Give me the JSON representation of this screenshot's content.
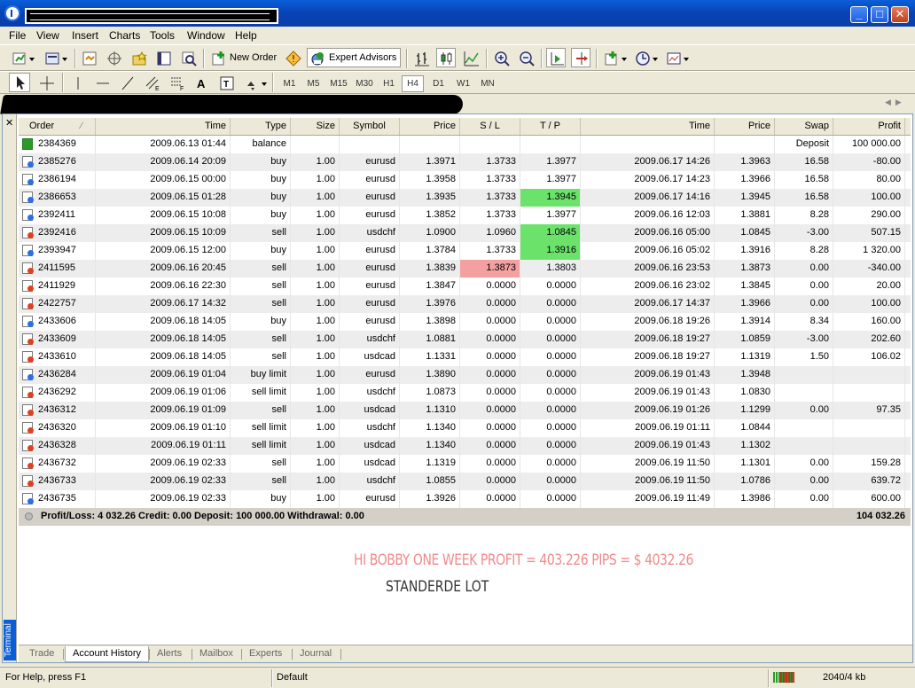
{
  "window": {
    "title": ""
  },
  "menu": [
    "File",
    "View",
    "Insert",
    "Charts",
    "Tools",
    "Window",
    "Help"
  ],
  "toolbar1": {
    "new_order": "New Order",
    "expert_advisors": "Expert Advisors"
  },
  "timeframes": [
    "M1",
    "M5",
    "M15",
    "M30",
    "H1",
    "H4",
    "D1",
    "W1",
    "MN"
  ],
  "timeframe_selected": "H4",
  "table": {
    "columns": [
      "Order",
      "Time",
      "Type",
      "Size",
      "Symbol",
      "Price",
      "S / L",
      "T / P",
      "Time",
      "Price",
      "Swap",
      "Profit"
    ],
    "rows": [
      [
        "2384369",
        "2009.06.13 01:44",
        "balance",
        "",
        "",
        "",
        "",
        "",
        "",
        "",
        "Deposit",
        "100 000.00"
      ],
      [
        "2385276",
        "2009.06.14 20:09",
        "buy",
        "1.00",
        "eurusd",
        "1.3971",
        "1.3733",
        "1.3977",
        "2009.06.17 14:26",
        "1.3963",
        "16.58",
        "-80.00"
      ],
      [
        "2386194",
        "2009.06.15 00:00",
        "buy",
        "1.00",
        "eurusd",
        "1.3958",
        "1.3733",
        "1.3977",
        "2009.06.17 14:23",
        "1.3966",
        "16.58",
        "80.00"
      ],
      [
        "2386653",
        "2009.06.15 01:28",
        "buy",
        "1.00",
        "eurusd",
        "1.3935",
        "1.3733",
        "1.3945",
        "2009.06.17 14:16",
        "1.3945",
        "16.58",
        "100.00"
      ],
      [
        "2392411",
        "2009.06.15 10:08",
        "buy",
        "1.00",
        "eurusd",
        "1.3852",
        "1.3733",
        "1.3977",
        "2009.06.16 12:03",
        "1.3881",
        "8.28",
        "290.00"
      ],
      [
        "2392416",
        "2009.06.15 10:09",
        "sell",
        "1.00",
        "usdchf",
        "1.0900",
        "1.0960",
        "1.0845",
        "2009.06.16 05:00",
        "1.0845",
        "-3.00",
        "507.15"
      ],
      [
        "2393947",
        "2009.06.15 12:00",
        "buy",
        "1.00",
        "eurusd",
        "1.3784",
        "1.3733",
        "1.3916",
        "2009.06.16 05:02",
        "1.3916",
        "8.28",
        "1 320.00"
      ],
      [
        "2411595",
        "2009.06.16 20:45",
        "sell",
        "1.00",
        "eurusd",
        "1.3839",
        "1.3873",
        "1.3803",
        "2009.06.16 23:53",
        "1.3873",
        "0.00",
        "-340.00"
      ],
      [
        "2411929",
        "2009.06.16 22:30",
        "sell",
        "1.00",
        "eurusd",
        "1.3847",
        "0.0000",
        "0.0000",
        "2009.06.16 23:02",
        "1.3845",
        "0.00",
        "20.00"
      ],
      [
        "2422757",
        "2009.06.17 14:32",
        "sell",
        "1.00",
        "eurusd",
        "1.3976",
        "0.0000",
        "0.0000",
        "2009.06.17 14:37",
        "1.3966",
        "0.00",
        "100.00"
      ],
      [
        "2433606",
        "2009.06.18 14:05",
        "buy",
        "1.00",
        "eurusd",
        "1.3898",
        "0.0000",
        "0.0000",
        "2009.06.18 19:26",
        "1.3914",
        "8.34",
        "160.00"
      ],
      [
        "2433609",
        "2009.06.18 14:05",
        "sell",
        "1.00",
        "usdchf",
        "1.0881",
        "0.0000",
        "0.0000",
        "2009.06.18 19:27",
        "1.0859",
        "-3.00",
        "202.60"
      ],
      [
        "2433610",
        "2009.06.18 14:05",
        "sell",
        "1.00",
        "usdcad",
        "1.1331",
        "0.0000",
        "0.0000",
        "2009.06.18 19:27",
        "1.1319",
        "1.50",
        "106.02"
      ],
      [
        "2436284",
        "2009.06.19 01:04",
        "buy limit",
        "1.00",
        "eurusd",
        "1.3890",
        "0.0000",
        "0.0000",
        "2009.06.19 01:43",
        "1.3948",
        "",
        ""
      ],
      [
        "2436292",
        "2009.06.19 01:06",
        "sell limit",
        "1.00",
        "usdchf",
        "1.0873",
        "0.0000",
        "0.0000",
        "2009.06.19 01:43",
        "1.0830",
        "",
        ""
      ],
      [
        "2436312",
        "2009.06.19 01:09",
        "sell",
        "1.00",
        "usdcad",
        "1.1310",
        "0.0000",
        "0.0000",
        "2009.06.19 01:26",
        "1.1299",
        "0.00",
        "97.35"
      ],
      [
        "2436320",
        "2009.06.19 01:10",
        "sell limit",
        "1.00",
        "usdchf",
        "1.1340",
        "0.0000",
        "0.0000",
        "2009.06.19 01:11",
        "1.0844",
        "",
        ""
      ],
      [
        "2436328",
        "2009.06.19 01:11",
        "sell limit",
        "1.00",
        "usdcad",
        "1.1340",
        "0.0000",
        "0.0000",
        "2009.06.19 01:43",
        "1.1302",
        "",
        ""
      ],
      [
        "2436732",
        "2009.06.19 02:33",
        "sell",
        "1.00",
        "usdcad",
        "1.1319",
        "0.0000",
        "0.0000",
        "2009.06.19 11:50",
        "1.1301",
        "0.00",
        "159.28"
      ],
      [
        "2436733",
        "2009.06.19 02:33",
        "sell",
        "1.00",
        "usdchf",
        "1.0855",
        "0.0000",
        "0.0000",
        "2009.06.19 11:50",
        "1.0786",
        "0.00",
        "639.72"
      ],
      [
        "2436735",
        "2009.06.19 02:33",
        "buy",
        "1.00",
        "eurusd",
        "1.3926",
        "0.0000",
        "0.0000",
        "2009.06.19 11:49",
        "1.3986",
        "0.00",
        "600.00"
      ]
    ],
    "highlights": {
      "green": [
        [
          3,
          7
        ],
        [
          5,
          7
        ],
        [
          6,
          7
        ]
      ],
      "red": [
        [
          7,
          6
        ]
      ]
    },
    "summary_text": "Profit/Loss: 4 032.26  Credit: 0.00  Deposit: 100 000.00  Withdrawal: 0.00",
    "summary_total": "104 032.26"
  },
  "notes": {
    "line1": "HI BOBBY  ONE WEEK PROFIT = 403.226 PIPS = $ 4032.26",
    "line2": "STANDERDE LOT"
  },
  "terminal_label": "Terminal",
  "tabs": [
    "Trade",
    "Account History",
    "Alerts",
    "Mailbox",
    "Experts",
    "Journal"
  ],
  "active_tab": "Account History",
  "status": {
    "help": "For Help, press F1",
    "profile": "Default",
    "traffic": "2040/4 kb"
  },
  "colors": {
    "title_blue": "#0842b4",
    "tp_hit_green": "#6be36b",
    "sl_hit_red": "#f4a0a0",
    "note_pink": "#f08a8a"
  }
}
